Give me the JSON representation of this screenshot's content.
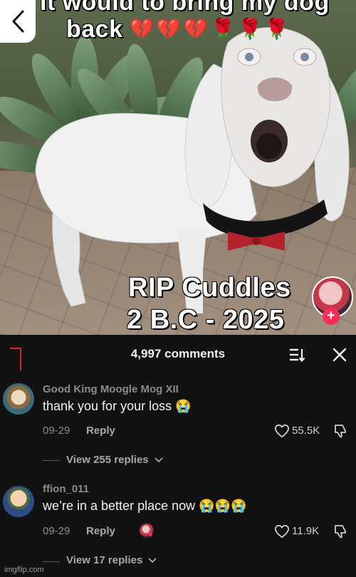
{
  "video": {
    "caption_line1": "it would to bring my dog",
    "caption_line2": "back",
    "caption_emojis": [
      "💔",
      "💔",
      "💔",
      "🌹",
      "🌹",
      "🌹"
    ],
    "rip_line1": "RIP Cuddles",
    "rip_line2": "2 B.C - 2025",
    "follow_symbol": "+"
  },
  "comments_panel": {
    "count_label": "4,997 comments",
    "comments": [
      {
        "username": "Good King Moogle Mog XII",
        "text": "thank you for your loss 😭",
        "date": "09-29",
        "reply_label": "Reply",
        "likes": "55.5K",
        "view_replies": "View 255 replies"
      },
      {
        "username": "ffion_011",
        "text": "we’re in a better place now 😭😭😭",
        "date": "09-29",
        "reply_label": "Reply",
        "likes": "11.9K",
        "view_replies": "View 17 replies"
      }
    ]
  },
  "watermark": "imgflip.com",
  "colors": {
    "sheet_bg": "#121212",
    "accent_red": "#fe2c55",
    "muted_text": "#8b8b8b"
  }
}
